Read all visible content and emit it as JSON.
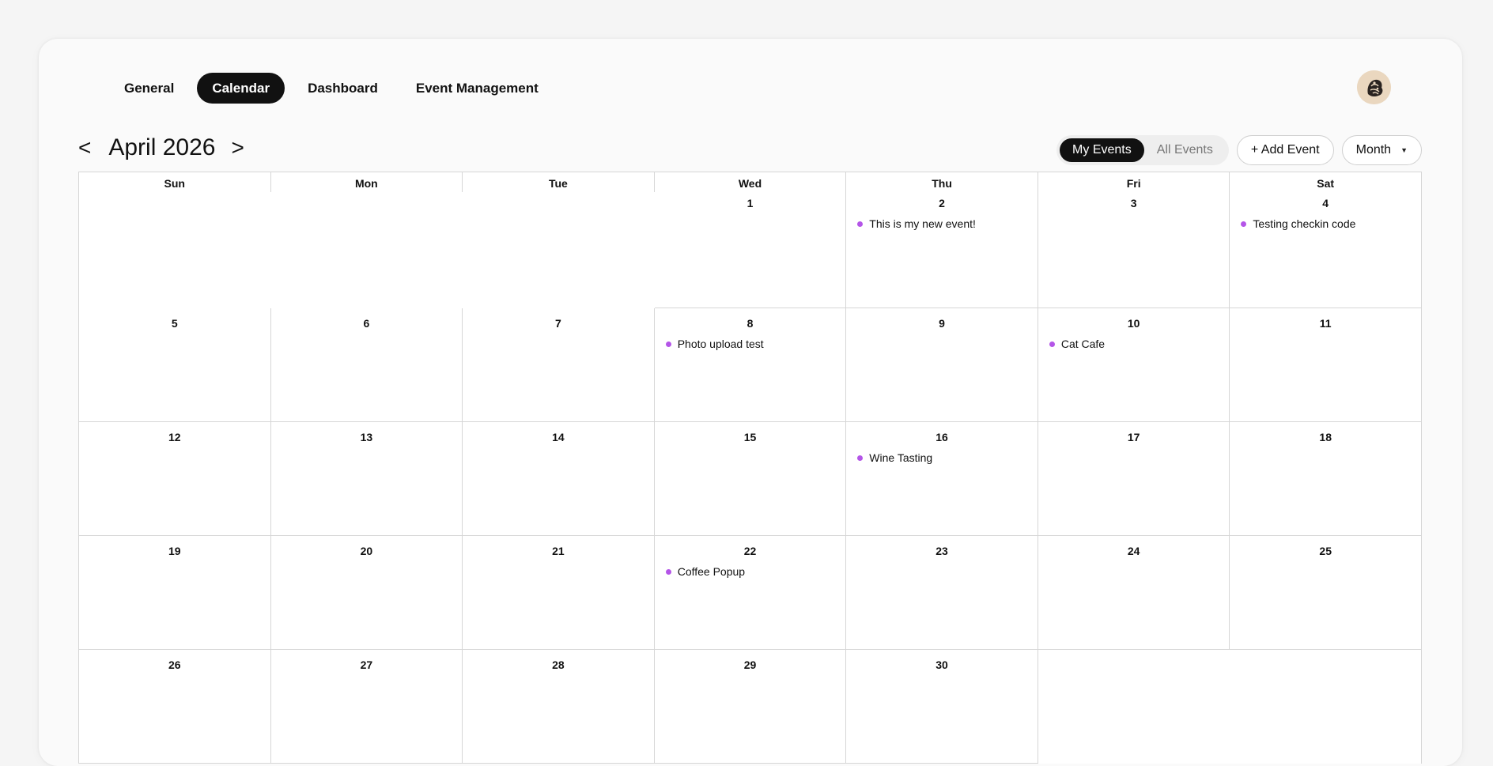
{
  "nav": {
    "tabs": [
      {
        "label": "General",
        "active": false
      },
      {
        "label": "Calendar",
        "active": true
      },
      {
        "label": "Dashboard",
        "active": false
      },
      {
        "label": "Event Management",
        "active": false
      }
    ]
  },
  "header": {
    "prev": "<",
    "next": ">",
    "month_title": "April 2026"
  },
  "controls": {
    "filter": [
      {
        "label": "My Events",
        "active": true
      },
      {
        "label": "All Events",
        "active": false
      }
    ],
    "add_event": "+ Add Event",
    "view": "Month"
  },
  "calendar": {
    "weekdays": [
      "Sun",
      "Mon",
      "Tue",
      "Wed",
      "Thu",
      "Fri",
      "Sat"
    ],
    "event_color": "#b455e8",
    "weeks": [
      [
        null,
        null,
        null,
        {
          "day": "1"
        },
        {
          "day": "2",
          "events": [
            "This is my new event!"
          ]
        },
        {
          "day": "3"
        },
        {
          "day": "4",
          "events": [
            "Testing checkin code"
          ]
        }
      ],
      [
        {
          "day": "5"
        },
        {
          "day": "6"
        },
        {
          "day": "7"
        },
        {
          "day": "8",
          "events": [
            "Photo upload test"
          ]
        },
        {
          "day": "9"
        },
        {
          "day": "10",
          "events": [
            "Cat Cafe"
          ]
        },
        {
          "day": "11"
        }
      ],
      [
        {
          "day": "12"
        },
        {
          "day": "13"
        },
        {
          "day": "14"
        },
        {
          "day": "15"
        },
        {
          "day": "16",
          "events": [
            "Wine Tasting"
          ]
        },
        {
          "day": "17"
        },
        {
          "day": "18"
        }
      ],
      [
        {
          "day": "19"
        },
        {
          "day": "20"
        },
        {
          "day": "21"
        },
        {
          "day": "22",
          "events": [
            "Coffee Popup"
          ]
        },
        {
          "day": "23"
        },
        {
          "day": "24"
        },
        {
          "day": "25"
        }
      ],
      [
        {
          "day": "26"
        },
        {
          "day": "27"
        },
        {
          "day": "28"
        },
        {
          "day": "29"
        },
        {
          "day": "30"
        },
        null,
        null
      ]
    ]
  },
  "avatar": {
    "icon": "user-avatar-image"
  }
}
